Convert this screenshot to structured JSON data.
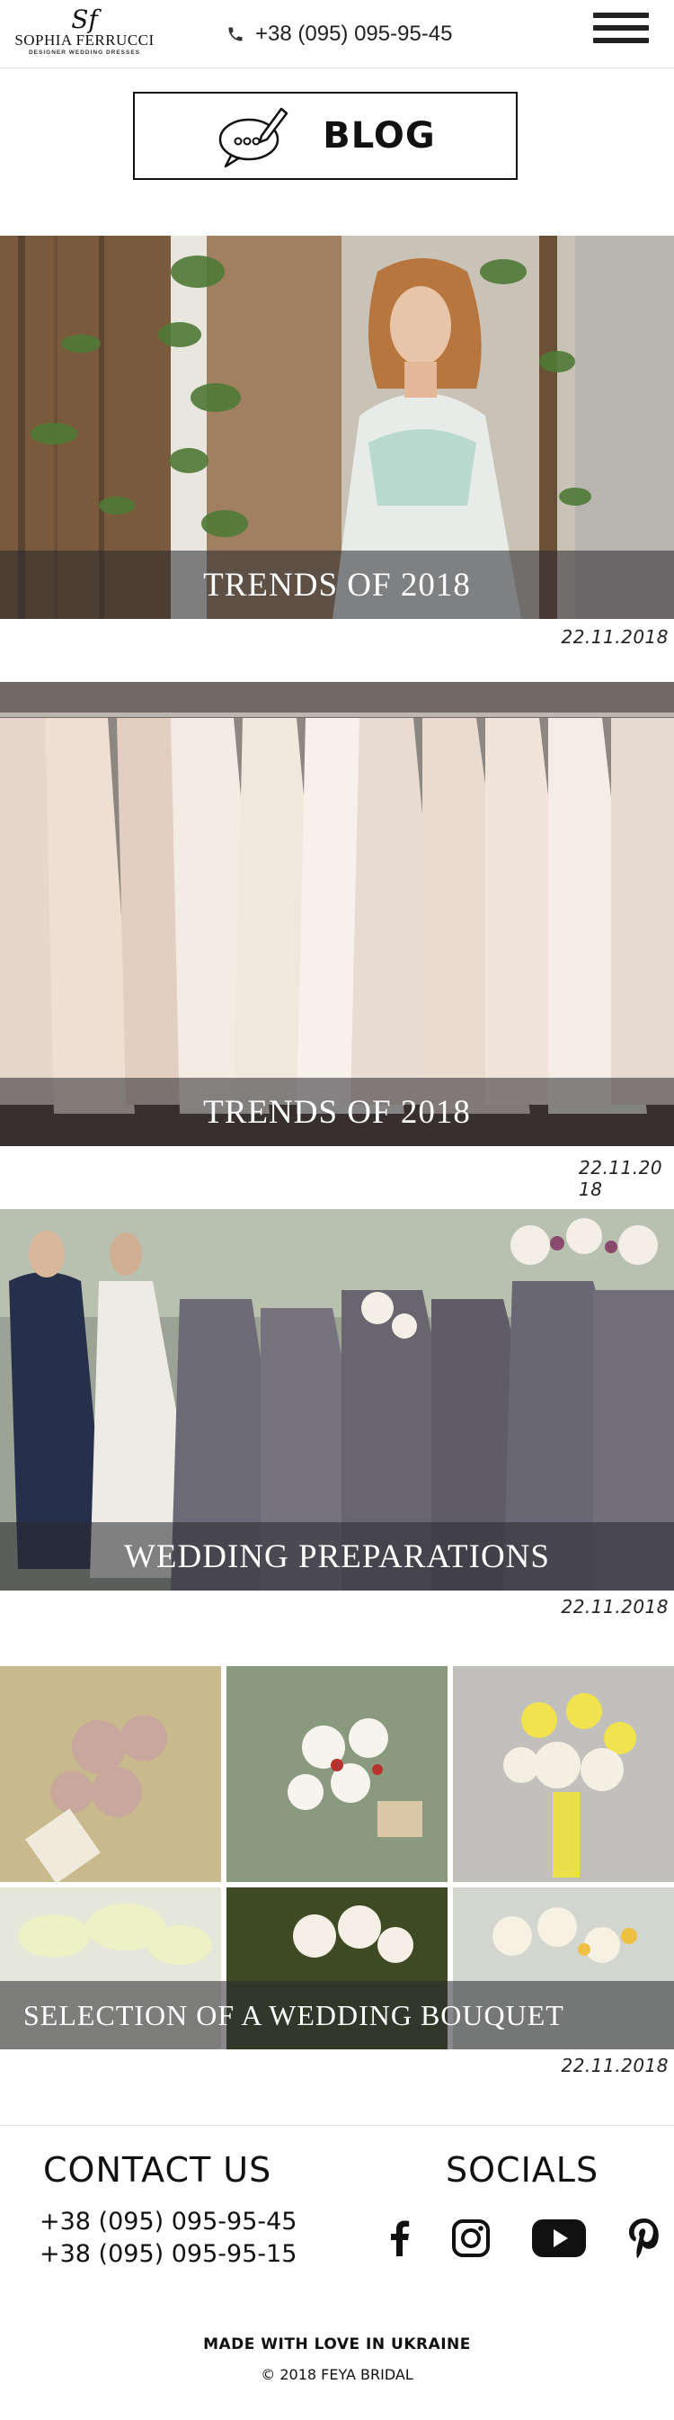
{
  "header": {
    "logo_mark": "Sf",
    "logo_name": "SOPHIA FERRUCCI",
    "logo_sub": "DESIGNER WEDDING DRESSES",
    "phone": "+38 (095) 095-95-45",
    "menu_icon": "hamburger-menu-icon"
  },
  "banner": {
    "title": "BLOG",
    "icon": "chat-bubble-pencil-icon"
  },
  "posts": [
    {
      "title": "TRENDS OF 2018",
      "date": "22.11.2018",
      "image": "bride-in-white-dress-photo"
    },
    {
      "title": "TRENDS OF 2018",
      "date": "22.11.2018",
      "image": "wedding-dresses-on-rack-photo"
    },
    {
      "title": "WEDDING PREPARATIONS",
      "date": "22.11.2018",
      "image": "bridesmaids-grey-dresses-photo"
    },
    {
      "title": "SELECTION OF A WEDDING BOUQUET",
      "date": "22.11.2018",
      "image": "wedding-bouquets-grid-photo"
    }
  ],
  "footer": {
    "contact_title": "CONTACT US",
    "phones": [
      "+38 (095) 095-95-45",
      "+38 (095) 095-95-15"
    ],
    "socials_title": "SOCIALS",
    "social_icons": [
      "facebook-icon",
      "instagram-icon",
      "youtube-icon",
      "pinterest-icon"
    ],
    "made_with": "MADE WITH LOVE IN UKRAINE",
    "copyright": "© 2018 FEYA BRIDAL"
  },
  "colors": {
    "caption_overlay": "#3a3a40",
    "text": "#111111",
    "background": "#ffffff"
  }
}
